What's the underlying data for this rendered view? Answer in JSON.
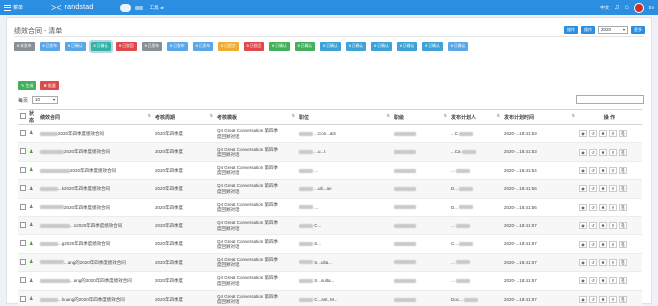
{
  "topbar": {
    "menu_label": "菜单",
    "brand": "randstad",
    "nav_label": "工具",
    "lang": "中文",
    "user": "Ev"
  },
  "page": {
    "title": "绩效合同 - 清单"
  },
  "header_actions": {
    "btn1": "操作",
    "btn2": "操作",
    "year": "2020",
    "btn3": "更多"
  },
  "tabs": [
    {
      "label": "未发布",
      "count": "0",
      "color": "#8a8f95"
    },
    {
      "label": "已发布",
      "count": "0",
      "color": "#5aa6e6"
    },
    {
      "label": "已确认",
      "count": "0",
      "color": "#5aa6e6"
    },
    {
      "label": "已确认",
      "count": "0",
      "color": "#34b3a3"
    },
    {
      "label": "已驳回",
      "count": "0",
      "color": "#e0494b"
    },
    {
      "label": "已发布",
      "count": "0",
      "color": "#8a8f95"
    },
    {
      "label": "已发布",
      "count": "0",
      "color": "#5aa6e6"
    },
    {
      "label": "已发布",
      "count": "0",
      "color": "#5aa6e6"
    },
    {
      "label": "已提交",
      "count": "0",
      "color": "#f0ac32"
    },
    {
      "label": "已驳回",
      "count": "0",
      "color": "#e0494b"
    },
    {
      "label": "已确认",
      "count": "0",
      "color": "#43b05c"
    },
    {
      "label": "已确认",
      "count": "0",
      "color": "#43b05c"
    },
    {
      "label": "已确认",
      "count": "0",
      "color": "#3fa2d6"
    },
    {
      "label": "已确认",
      "count": "0",
      "color": "#3fa2d6"
    },
    {
      "label": "已确认",
      "count": "0",
      "color": "#3fa2d6"
    },
    {
      "label": "已确认",
      "count": "0",
      "color": "#3fa2d6"
    },
    {
      "label": "已确认",
      "count": "0",
      "color": "#3fa2d6"
    },
    {
      "label": "已确认",
      "count": "0",
      "color": "#5aa6e6"
    }
  ],
  "actions": {
    "generate": "生成",
    "batch": "批量"
  },
  "pager": {
    "label": "每页",
    "value": "10"
  },
  "table": {
    "headers": [
      "状态",
      "绩效合同",
      "考核周期",
      "考核模板",
      "职位",
      "职级",
      "发布计划人",
      "发布计划时间",
      "操 作"
    ],
    "rows": [
      {
        "name": "2020年四季度绩效合同",
        "period": "2020年四季度",
        "tpl1": "Q4 Great Conversation 第四季",
        "tpl2": "度回顾对话",
        "pos": "...Con...&S",
        "pub": "...C",
        "time": "2020-...18:41:53"
      },
      {
        "name": "2020年四季度绩效合同",
        "period": "2020年四季度",
        "tpl1": "Q4 Great Conversation 第四季",
        "tpl2": "度回顾对话",
        "pos": "...u...t",
        "pub": "...Ca",
        "time": "2020-...18:41:53"
      },
      {
        "name": "2020年四季度绩效合同",
        "period": "2020年四季度",
        "tpl1": "Q4 Great Conversation 第四季",
        "tpl2": "度回顾对话",
        "pos": "...",
        "pub": "...",
        "time": "2020-...18:41:54"
      },
      {
        "name": "...k2020年四季度绩效合同",
        "period": "2020年四季度",
        "tpl1": "Q4 Great Conversation 第四季",
        "tpl2": "度回顾对话",
        "pos": "...ult...an",
        "pub": "D...",
        "time": "2020-...18:41:56"
      },
      {
        "name": "2020年四季度绩效合同",
        "period": "2020年四季度",
        "tpl1": "Q4 Great Conversation 第四季",
        "tpl2": "度回顾对话",
        "pos": "...",
        "pub": "D...",
        "time": "2020-...18:41:56"
      },
      {
        "name": "...n2020年四季度绩效合同",
        "period": "2020年四季度",
        "tpl1": "Q4 Great Conversation 第四季",
        "tpl2": "度回顾对话",
        "pos": "C...",
        "pub": "...",
        "time": "2020-...18:41:57"
      },
      {
        "name": "...g2020年四季度绩效合同",
        "period": "2020年四季度",
        "tpl1": "Q4 Great Conversation 第四季",
        "tpl2": "度回顾对话",
        "pos": "S...",
        "pub": "C...",
        "time": "2020-...18:41:57"
      },
      {
        "name": "...ang的2020年四季度绩效合同",
        "period": "2020年四季度",
        "tpl1": "Q4 Great Conversation 第四季",
        "tpl2": "度回顾对话",
        "pos": "S...ulta...",
        "pub": "...",
        "time": "2020-...18:41:57"
      },
      {
        "name": "...ang的2020年四季度绩效合同",
        "period": "2020年四季度",
        "tpl1": "Q4 Great Conversation 第四季",
        "tpl2": "度回顾对话",
        "pos": "S...sulta...",
        "pub": "...",
        "time": "2020-...18:41:57"
      },
      {
        "name": "...huang的2020年四季度绩效合同",
        "period": "2020年四季度",
        "tpl1": "Q4 Great Conversation 第四季",
        "tpl2": "度回顾对话",
        "pos": "C...ant, M...",
        "pub": "Doc...",
        "time": "2020-...18:41:57"
      }
    ]
  }
}
